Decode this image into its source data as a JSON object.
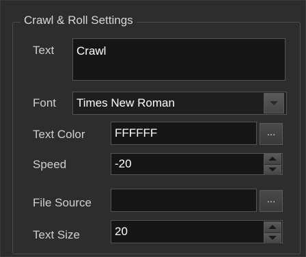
{
  "group": {
    "title": "Crawl & Roll Settings"
  },
  "fields": {
    "text": {
      "label": "Text",
      "value": "Crawl"
    },
    "font": {
      "label": "Font",
      "value": "Times New Roman"
    },
    "text_color": {
      "label": "Text Color",
      "value": "FFFFFF",
      "button": "..."
    },
    "speed": {
      "label": "Speed",
      "value": "-20"
    },
    "file_source": {
      "label": "File Source",
      "value": "",
      "button": "..."
    },
    "text_size": {
      "label": "Text Size",
      "value": "20"
    }
  },
  "icons": {
    "font_dropdown": "chevron-down-icon",
    "speed_spinner": "spin-arrows-icon",
    "size_spinner": "spin-arrows-icon"
  }
}
